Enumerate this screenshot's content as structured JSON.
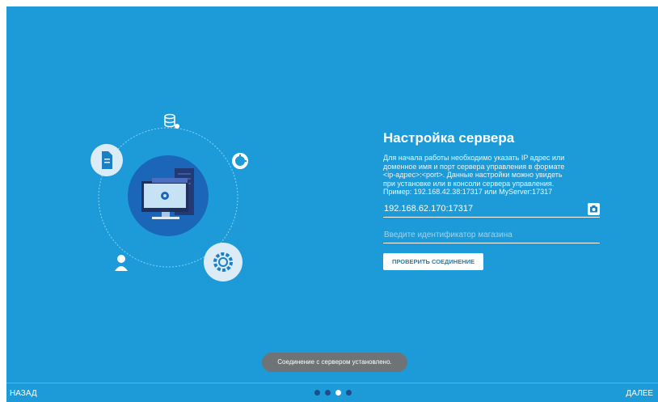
{
  "panel": {
    "title": "Настройка сервера",
    "description": "Для начала работы необходимо указать IP адрес или\nдоменное имя и порт сервера управления в формате\n<ip-адрес>:<port>. Данные настройки можно увидеть\nпри установке или в консоли сервера управления.\nПример: 192.168.42.38:17317 или MyServer:17317",
    "server_value": "192.168.62.170:17317",
    "store_placeholder": "Введите идентификатор магазина",
    "check_button_label": "ПРОВЕРИТЬ СОЕДИНЕНИЕ"
  },
  "toast": {
    "text": "Соединение с сервером установлено."
  },
  "nav": {
    "back_label": "НАЗАД",
    "next_label": "ДАЛЕЕ"
  },
  "pager": {
    "total": 4,
    "active_index": 2
  },
  "icons": {
    "camera": "camera-icon",
    "database": "database-settings-icon",
    "document": "document-icon",
    "pie": "pie-chart-icon",
    "user": "user-icon",
    "gear": "gear-icon",
    "computer": "computer-server-icon"
  },
  "colors": {
    "background": "#1c9bd8",
    "circle_dark": "#1b66b8",
    "circle_light": "#dcecf7",
    "toast": "#6e7378",
    "pager_inactive": "#1a4f8c"
  }
}
